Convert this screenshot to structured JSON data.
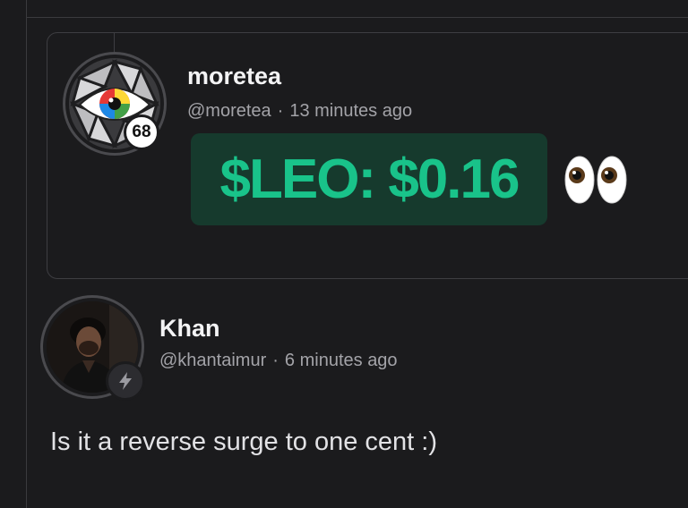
{
  "quoted_post": {
    "display_name": "moretea",
    "handle": "@moretea",
    "separator": "·",
    "time": "13 minutes ago",
    "reputation": "68",
    "price_text": "$LEO: $0.16",
    "emoji_icon": "eyes-emoji",
    "price_color": "#19c38a",
    "price_bg": "#163a2d"
  },
  "reply": {
    "display_name": "Khan",
    "handle": "@khantaimur",
    "separator": "·",
    "time": "6 minutes ago",
    "badge_icon": "lightning-bolt-icon",
    "body": "Is it a reverse surge to one cent :)"
  }
}
